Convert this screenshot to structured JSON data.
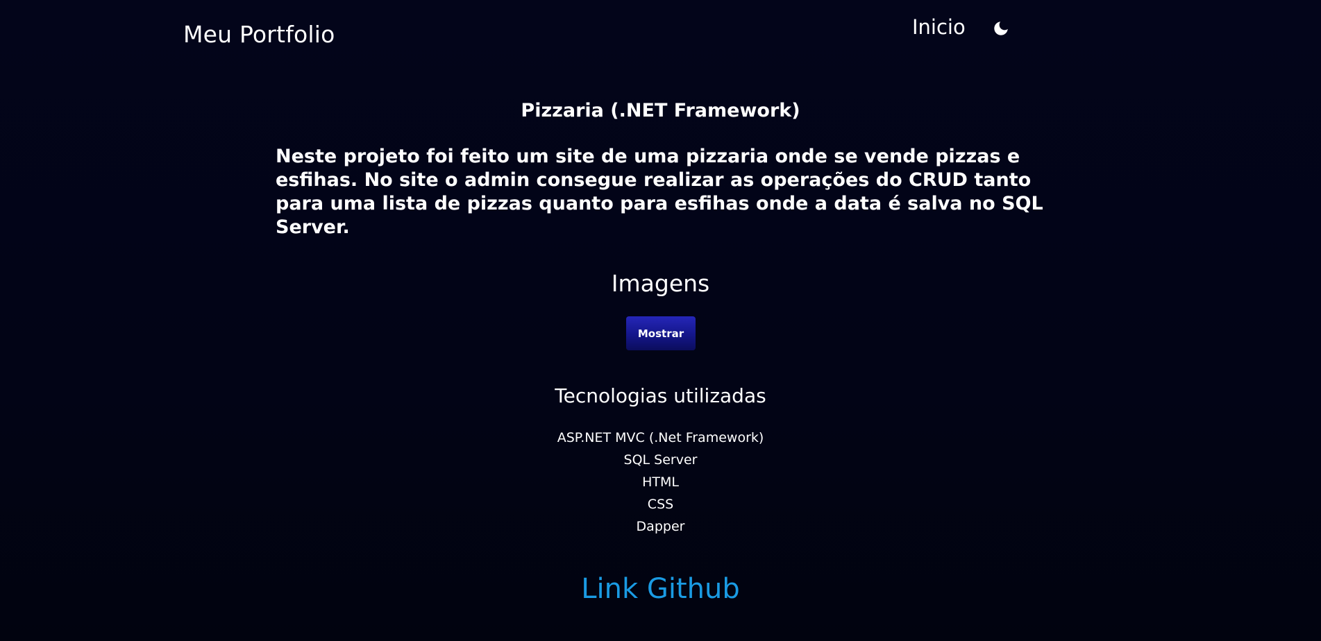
{
  "header": {
    "brand": "Meu Portfolio",
    "nav_home": "Inicio",
    "theme_icon": "moon-icon"
  },
  "project": {
    "title": "Pizzaria (.NET Framework)",
    "description": "Neste projeto foi feito um site de uma pizzaria onde se vende pizzas e esfihas. No site o admin consegue realizar as operações do CRUD tanto para uma lista de pizzas quanto para esfihas onde a data é salva no SQL Server."
  },
  "images": {
    "heading": "Imagens",
    "show_button": "Mostrar"
  },
  "technologies": {
    "heading": "Tecnologias utilizadas",
    "items": [
      "ASP.NET MVC (.Net Framework)",
      "SQL Server",
      "HTML",
      "CSS",
      "Dapper"
    ]
  },
  "github": {
    "label": "Link Github"
  },
  "colors": {
    "background": "#020417",
    "text": "#ffffff",
    "button": "#1a1c9e",
    "link": "#1a9be3"
  }
}
